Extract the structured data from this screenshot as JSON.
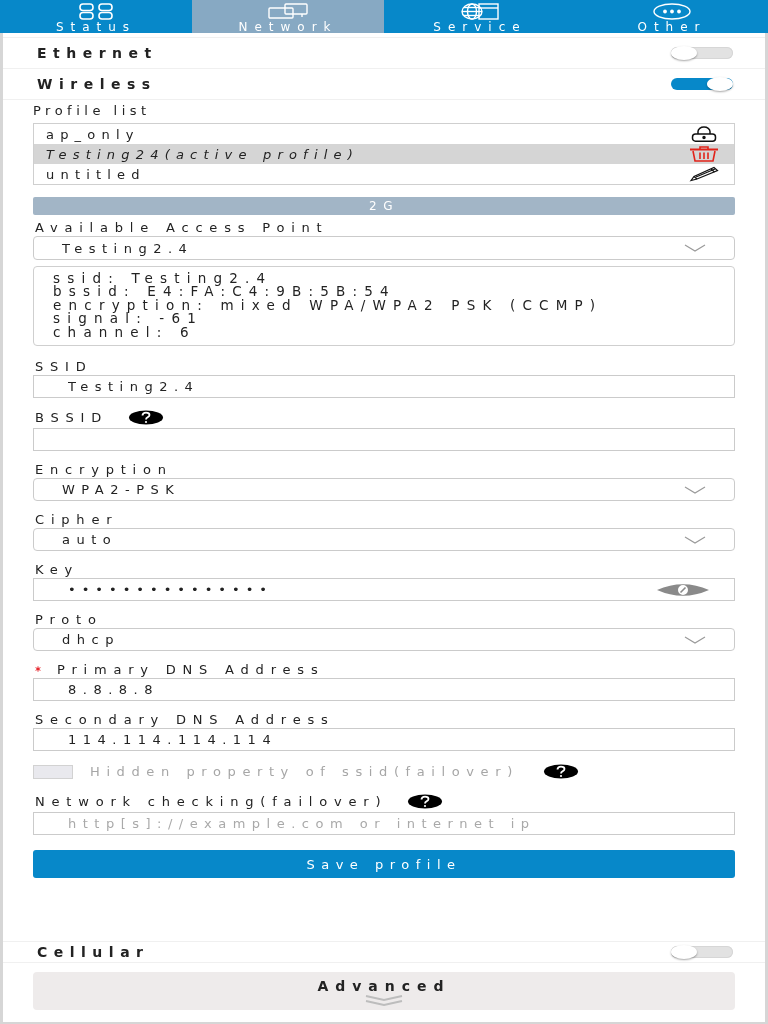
{
  "tabs": [
    {
      "label": "Status",
      "kind": "grid",
      "selected": false
    },
    {
      "label": "Network",
      "kind": "monitors",
      "selected": true
    },
    {
      "label": "Service",
      "kind": "globe",
      "selected": false
    },
    {
      "label": "Other",
      "kind": "chat",
      "selected": false
    }
  ],
  "interfaces": [
    {
      "label": "Ethernet",
      "on": false
    },
    {
      "label": "Wireless",
      "on": true
    }
  ],
  "profile_list": {
    "label": "Profile list",
    "items": [
      {
        "name": "ap_only",
        "kind": "lock",
        "selected": false
      },
      {
        "name": "Testing24(active profile)",
        "kind": "delete",
        "selected": true
      },
      {
        "name": "untitled",
        "kind": "edit",
        "selected": false
      }
    ]
  },
  "band": "2G",
  "access_point": {
    "label": "Available Access Point",
    "value": "Testing2.4",
    "details": [
      "ssid: Testing2.4",
      "bssid: E4:FA:C4:9B:5B:54",
      "encryption: mixed WPA/WPA2 PSK (CCMP)",
      "signal: -61",
      "channel: 6"
    ]
  },
  "fields": [
    {
      "kind": "input",
      "label": "SSID",
      "value": "Testing2.4",
      "required": false,
      "help": false
    },
    {
      "kind": "input",
      "label": "BSSID",
      "required": false,
      "help": true
    },
    {
      "kind": "select",
      "label": "Encryption",
      "value": "WPA2-PSK",
      "required": false,
      "help": false
    },
    {
      "kind": "select",
      "label": "Cipher",
      "value": "auto",
      "required": false,
      "help": false
    },
    {
      "kind": "password",
      "label": "Key",
      "value": "•••••••••••••••",
      "required": false,
      "help": false
    },
    {
      "kind": "select",
      "label": "Proto",
      "value": "dhcp",
      "required": false,
      "help": false
    },
    {
      "kind": "input",
      "label": "Primary DNS Address",
      "value": "8.8.8.8",
      "required": true,
      "help": false
    },
    {
      "kind": "input",
      "label": "Secondary DNS Address",
      "value": "114.114.114.114",
      "required": false,
      "help": false
    },
    {
      "kind": "checkbox",
      "label": "Hidden property of ssid(failover)",
      "checked": false,
      "disabled": true,
      "required": false,
      "help": true
    },
    {
      "kind": "input",
      "label": "Network checking(failover)",
      "placeholder": "http[s]://example.com or internet ip",
      "required": false,
      "help": true
    }
  ],
  "save_button": "Save profile",
  "cellular": {
    "label": "Cellular",
    "on": false
  },
  "advanced_button": "Advanced"
}
